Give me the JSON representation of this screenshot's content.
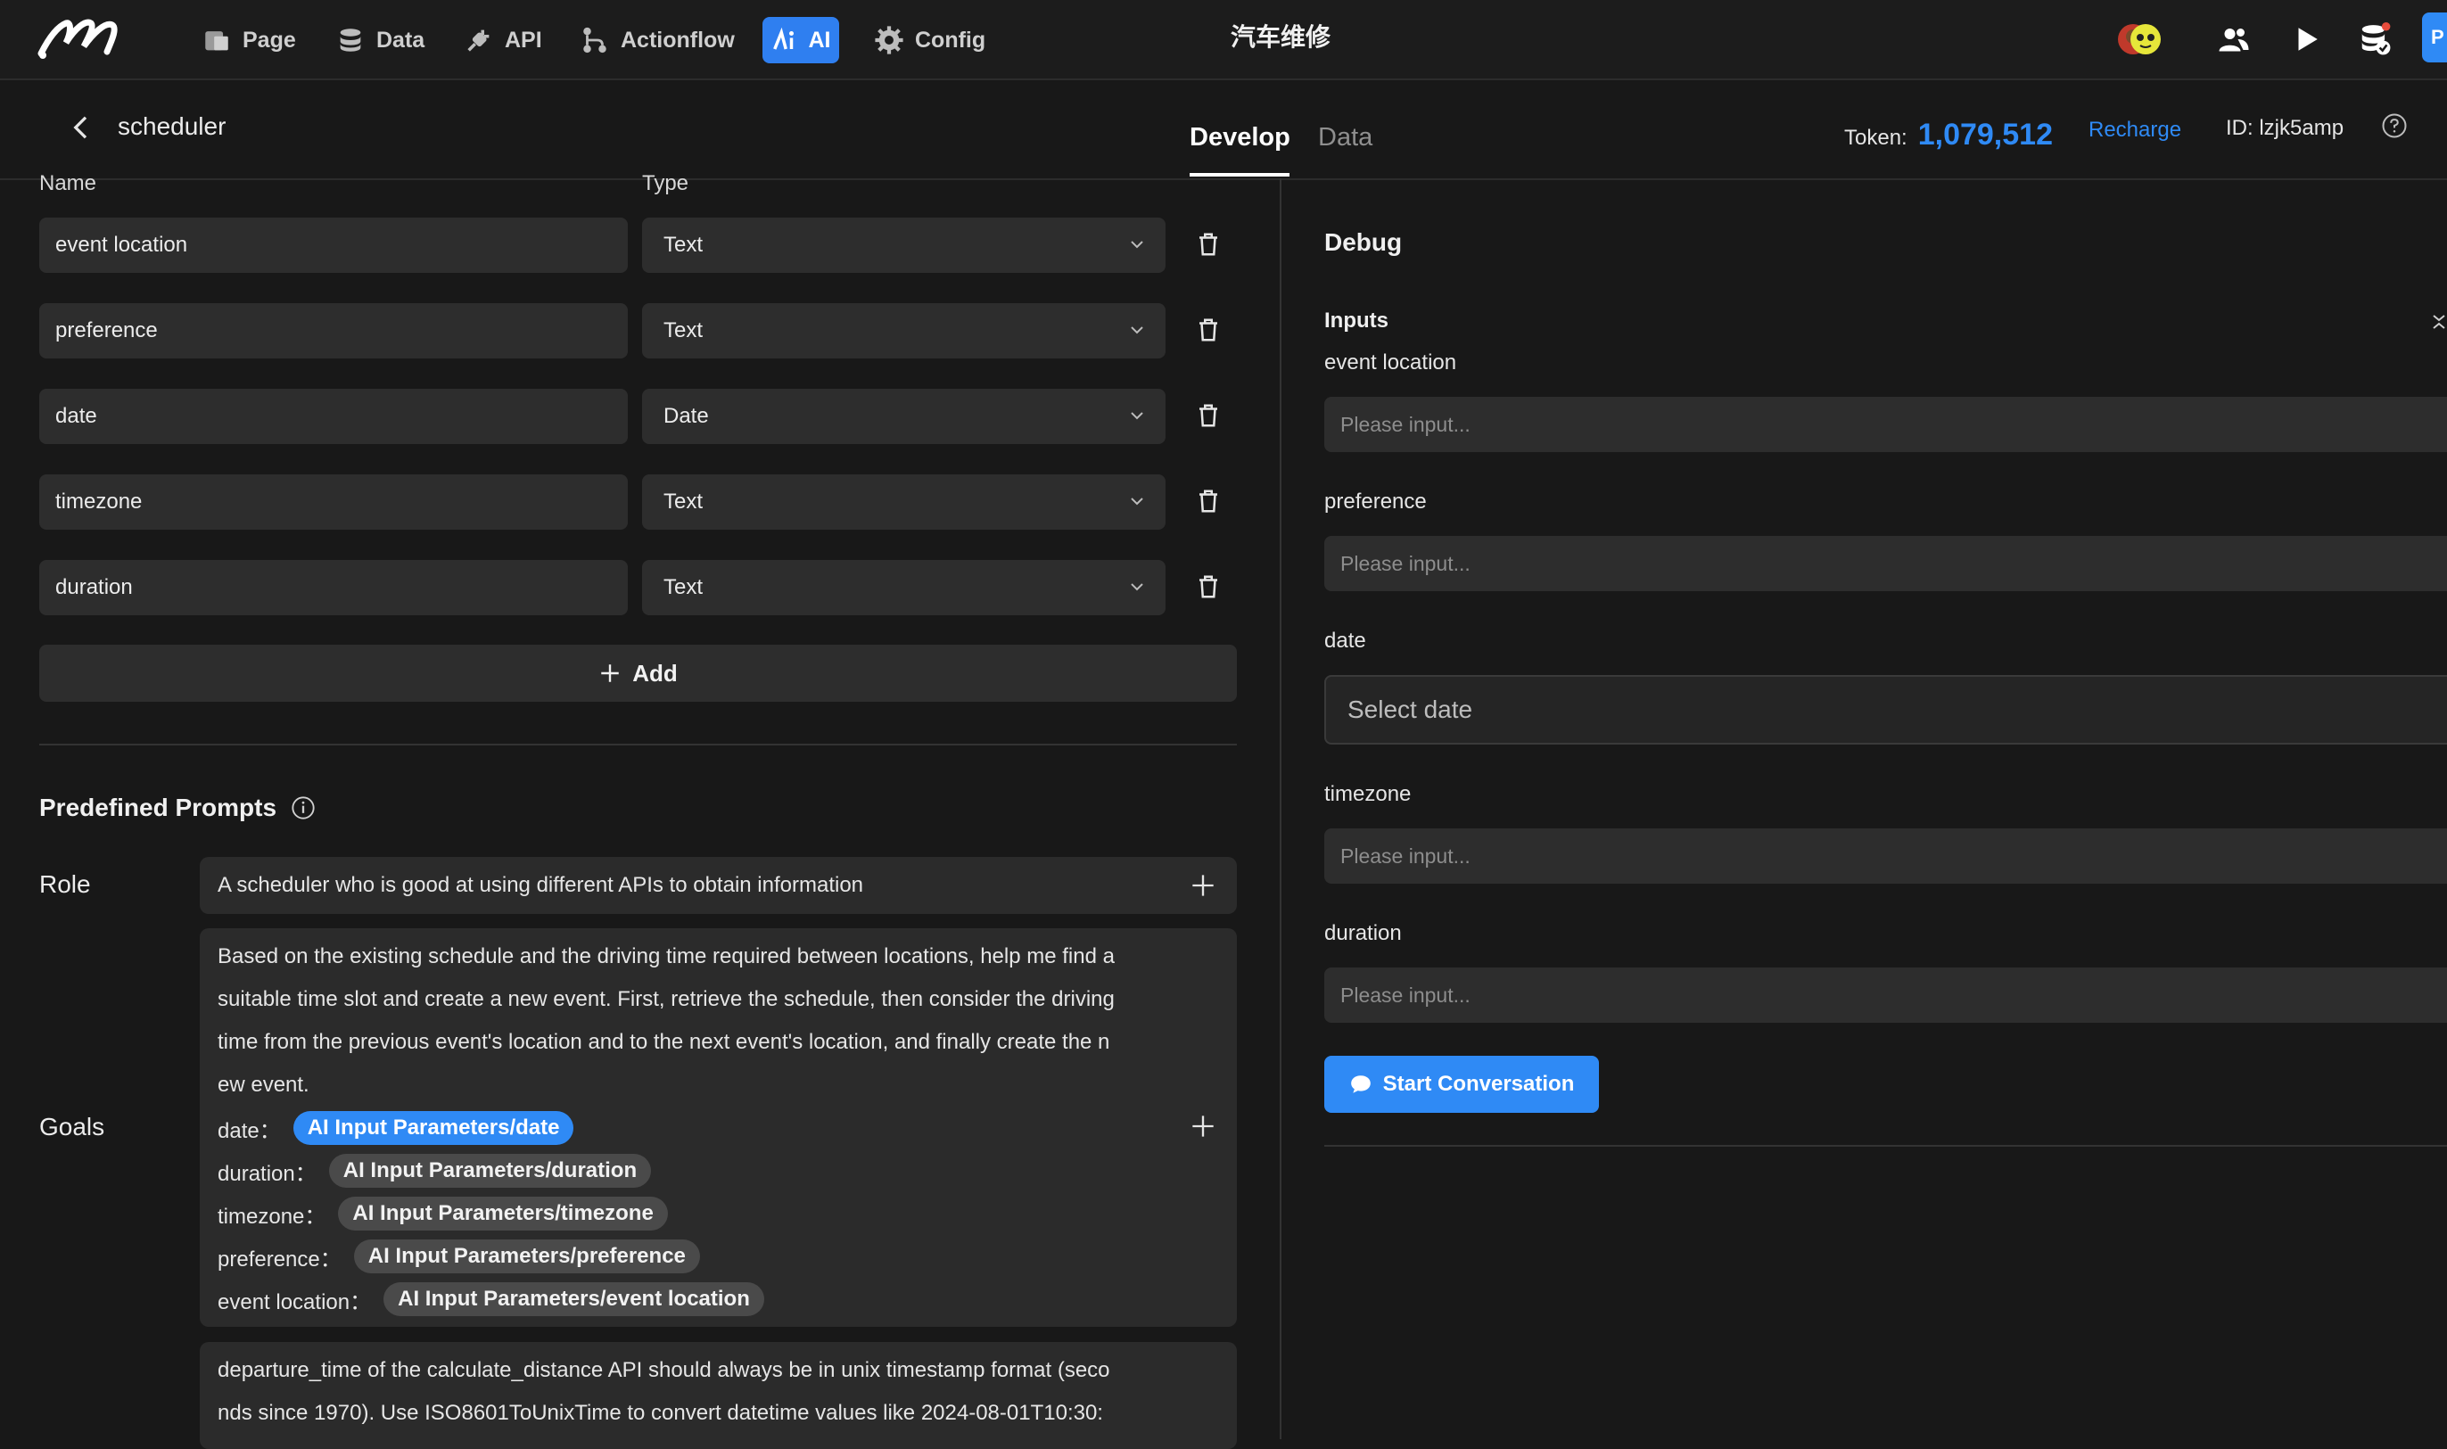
{
  "nav": {
    "items": [
      {
        "label": "Page",
        "icon": "page-icon"
      },
      {
        "label": "Data",
        "icon": "database-icon"
      },
      {
        "label": "API",
        "icon": "plug-icon"
      },
      {
        "label": "Actionflow",
        "icon": "flow-icon"
      },
      {
        "label": "AI",
        "icon": "ai-icon",
        "active": true
      },
      {
        "label": "Config",
        "icon": "gear-icon"
      }
    ],
    "app_title": "汽车维修"
  },
  "header": {
    "back_title": "scheduler",
    "tabs": [
      {
        "label": "Develop",
        "active": true
      },
      {
        "label": "Data",
        "active": false
      }
    ],
    "token_label": "Token:",
    "token_value": "1,079,512",
    "recharge": "Recharge",
    "id_text": "ID: lzjk5amp"
  },
  "params": {
    "col_name": "Name",
    "col_type": "Type",
    "rows": [
      {
        "name": "event location",
        "type": "Text"
      },
      {
        "name": "preference",
        "type": "Text"
      },
      {
        "name": "date",
        "type": "Date"
      },
      {
        "name": "timezone",
        "type": "Text"
      },
      {
        "name": "duration",
        "type": "Text"
      }
    ],
    "add_label": "Add"
  },
  "prompts": {
    "title": "Predefined Prompts",
    "role_label": "Role",
    "role_text": "A scheduler who is good at using different APIs to obtain information",
    "goals_label": "Goals",
    "goals_lines": [
      "Based on the existing schedule and the driving time required between locations, help me find a",
      "suitable time slot and create a new event. First, retrieve the schedule, then consider the driving",
      "time from the previous event's location and to the next event's location, and finally create the n",
      "ew event."
    ],
    "goal_params": [
      {
        "key": "date：",
        "chip": "AI Input Parameters/date",
        "highlight": true
      },
      {
        "key": "duration：",
        "chip": "AI Input Parameters/duration",
        "highlight": false
      },
      {
        "key": "timezone：",
        "chip": "AI Input Parameters/timezone",
        "highlight": false
      },
      {
        "key": "preference：",
        "chip": "AI Input Parameters/preference",
        "highlight": false
      },
      {
        "key": "event location：",
        "chip": "AI Input Parameters/event location",
        "highlight": false
      }
    ],
    "extra_lines": [
      "departure_time of the calculate_distance API should always be in unix timestamp format (seco",
      "nds since 1970). Use ISO8601ToUnixTime to convert datetime values like 2024-08-01T10:30:"
    ]
  },
  "debug": {
    "title": "Debug",
    "inputs_label": "Inputs",
    "fields": [
      {
        "label": "event location",
        "placeholder": "Please input..."
      },
      {
        "label": "preference",
        "placeholder": "Please input..."
      },
      {
        "label": "date",
        "placeholder": "Select date"
      },
      {
        "label": "timezone",
        "placeholder": "Please input..."
      },
      {
        "label": "duration",
        "placeholder": "Please input..."
      }
    ],
    "start_button": "Start Conversation"
  },
  "colors": {
    "accent": "#2f8af5",
    "background": "#181818",
    "surface": "#2d2d2d"
  }
}
